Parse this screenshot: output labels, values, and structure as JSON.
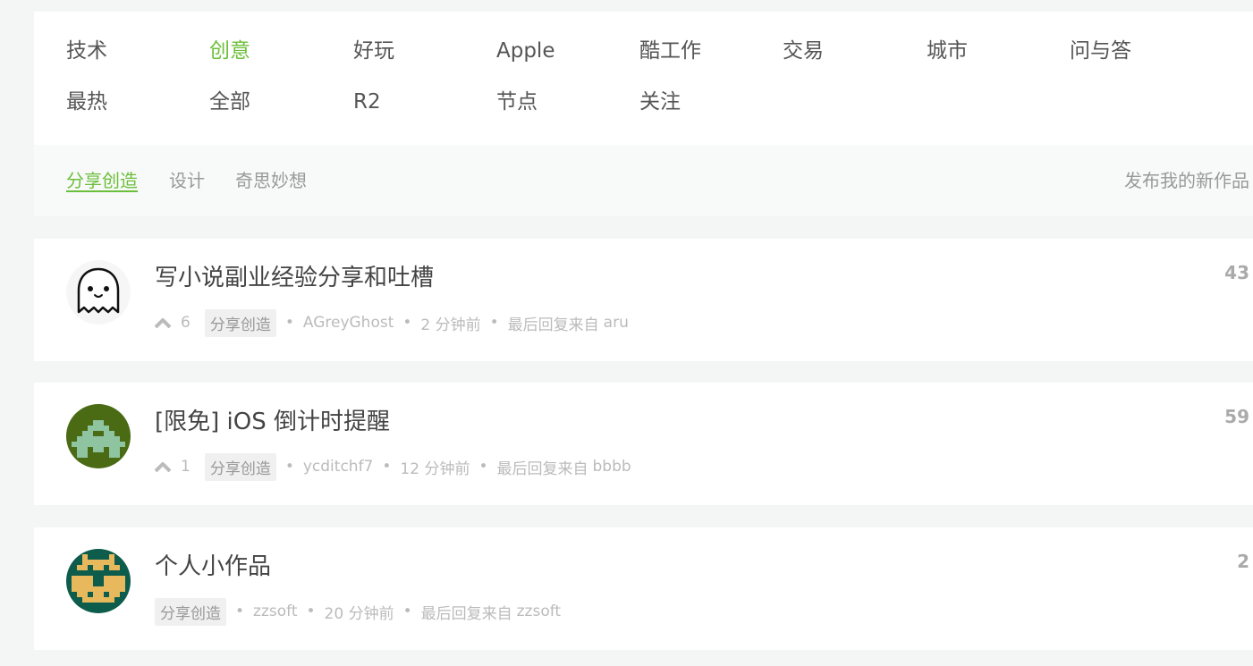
{
  "tabs": [
    {
      "label": "技术",
      "active": false
    },
    {
      "label": "创意",
      "active": true
    },
    {
      "label": "好玩",
      "active": false
    },
    {
      "label": "Apple",
      "active": false
    },
    {
      "label": "酷工作",
      "active": false
    },
    {
      "label": "交易",
      "active": false
    },
    {
      "label": "城市",
      "active": false
    },
    {
      "label": "问与答",
      "active": false
    },
    {
      "label": "最热",
      "active": false
    },
    {
      "label": "全部",
      "active": false
    },
    {
      "label": "R2",
      "active": false
    },
    {
      "label": "节点",
      "active": false
    },
    {
      "label": "关注",
      "active": false
    }
  ],
  "subnav": {
    "items": [
      {
        "label": "分享创造",
        "active": true
      },
      {
        "label": "设计",
        "active": false
      },
      {
        "label": "奇思妙想",
        "active": false
      }
    ],
    "publish_label": "发布我的新作品"
  },
  "topics": [
    {
      "title": "写小说副业经验分享和吐槽",
      "votes": "6",
      "node": "分享创造",
      "author": "AGreyGhost",
      "time": "2 分钟前",
      "last_reply_prefix": "最后回复来自",
      "last_reply_user": "aru",
      "replies": "43",
      "avatar_icon": "ghost-avatar"
    },
    {
      "title": "[限免] iOS 倒计时提醒",
      "votes": "1",
      "node": "分享创造",
      "author": "ycditchf7",
      "time": "12 分钟前",
      "last_reply_prefix": "最后回复来自",
      "last_reply_user": "bbbb",
      "replies": "59",
      "avatar_icon": "pixel-invader-avatar-green"
    },
    {
      "title": "个人小作品",
      "votes": "",
      "node": "分享创造",
      "author": "zzsoft",
      "time": "20 分钟前",
      "last_reply_prefix": "最后回复来自",
      "last_reply_user": "zzsoft",
      "replies": "2",
      "avatar_icon": "pixel-invader-avatar-teal"
    }
  ],
  "colors": {
    "accent": "#6cbf3a",
    "text": "#555555",
    "muted": "#999999",
    "light": "#bbbbbb"
  }
}
